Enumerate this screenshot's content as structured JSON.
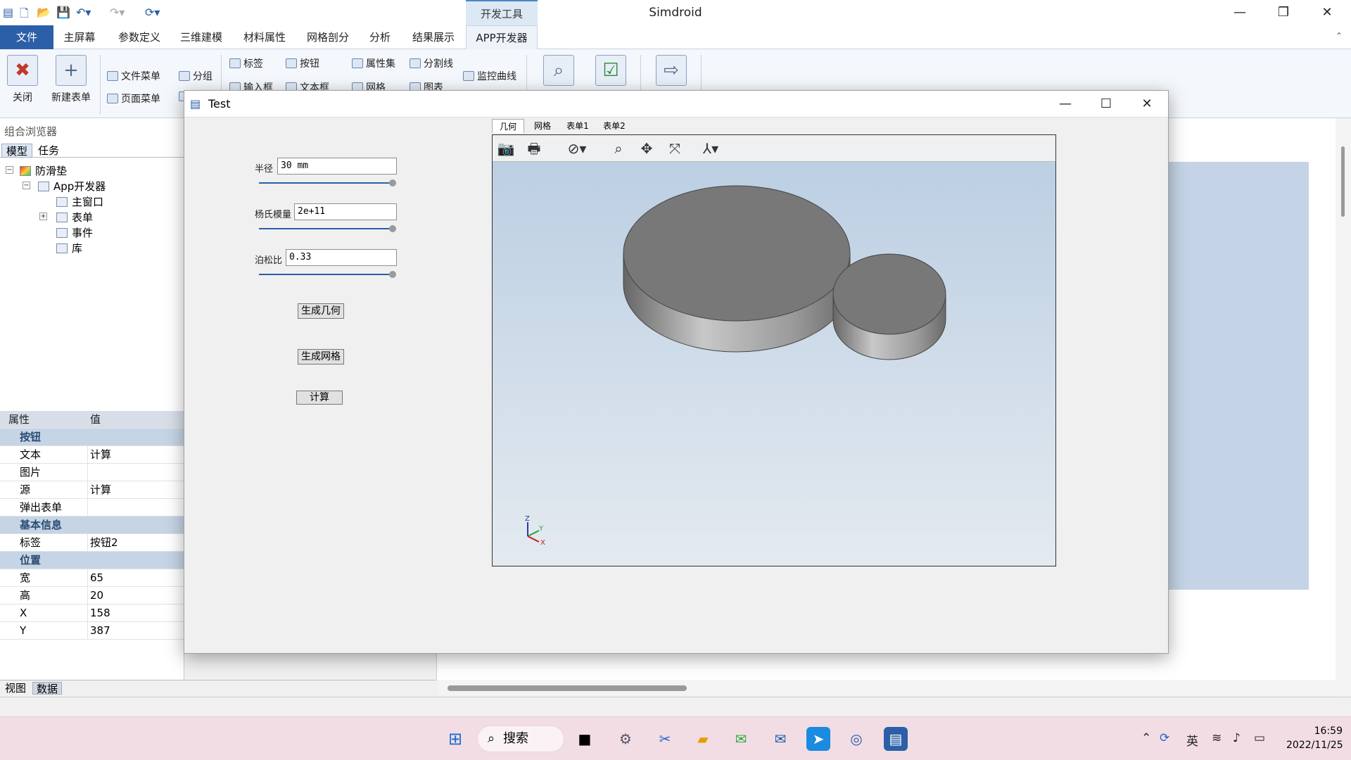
{
  "window": {
    "title": "Simdroid",
    "context_tab": "开发工具"
  },
  "tabs": [
    "文件",
    "主屏幕",
    "参数定义",
    "三维建模",
    "材料属性",
    "网格剖分",
    "分析",
    "结果展示",
    "APP开发器"
  ],
  "ribbon": {
    "close": "关闭",
    "new_form": "新建表单",
    "file_menu": "文件菜单",
    "page_menu": "页面菜单",
    "group": "分组",
    "label": "标签",
    "button": "按钮",
    "input": "输入框",
    "textbox": "文本框",
    "property_set": "属性集",
    "divider": "分割线",
    "grid": "网格",
    "chart": "图表",
    "monitor_curve": "监控曲线"
  },
  "browser": {
    "title": "组合浏览器",
    "tabs": [
      "模型",
      "任务"
    ],
    "tree": {
      "root": "防滑垫",
      "app": "App开发器",
      "children": [
        "主窗口",
        "表单",
        "事件",
        "库"
      ]
    }
  },
  "props": {
    "header": {
      "key": "属性",
      "value": "值"
    },
    "groups": [
      {
        "name": "按钮",
        "rows": [
          [
            "文本",
            "计算"
          ],
          [
            "图片",
            ""
          ],
          [
            "源",
            "计算"
          ],
          [
            "弹出表单",
            ""
          ]
        ]
      },
      {
        "name": "基本信息",
        "rows": [
          [
            "标签",
            "按钮2"
          ]
        ]
      },
      {
        "name": "位置",
        "rows": [
          [
            "宽",
            "65"
          ],
          [
            "高",
            "20"
          ],
          [
            "X",
            "158"
          ],
          [
            "Y",
            "387"
          ]
        ]
      }
    ]
  },
  "bottom_tabs": [
    "视图",
    "数据"
  ],
  "dialog": {
    "title": "Test",
    "fields": [
      {
        "label": "半径",
        "value": "30 mm",
        "slider": 1.0
      },
      {
        "label": "杨氏模量",
        "value": "2e+11",
        "slider": 1.0
      },
      {
        "label": "泊松比",
        "value": "0.33",
        "slider": 1.0
      }
    ],
    "buttons": [
      "生成几何",
      "生成网格",
      "计算"
    ],
    "view_tabs": [
      "几何",
      "网格",
      "表单1",
      "表单2"
    ],
    "axis": {
      "z": "Z",
      "y": "Y",
      "x": "X"
    }
  },
  "taskbar": {
    "search": "搜索",
    "ime": "英",
    "time": "16:59",
    "date": "2022/11/25"
  },
  "colors": {
    "accent": "#2b5fa8",
    "taskbar": "#f3dde5",
    "viewport_top": "#b9cde2"
  }
}
